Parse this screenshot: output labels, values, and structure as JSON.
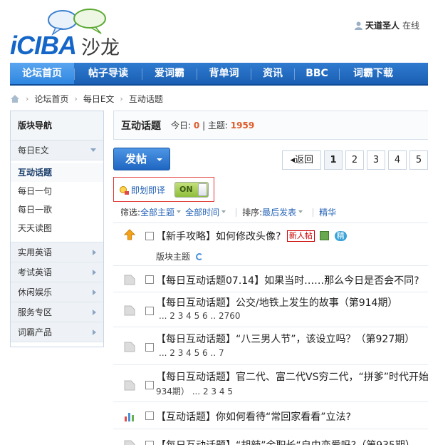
{
  "brand": {
    "logo_text": "iCIBA",
    "logo_cn": "沙龙",
    "colors": {
      "primary": "#1466c8",
      "nav": "#1a5fb3",
      "accent_red": "#e05a2a"
    }
  },
  "user": {
    "name": "天道圣人",
    "status": "在线"
  },
  "nav": {
    "items": [
      "论坛首页",
      "帖子导读",
      "爱词霸",
      "背单词",
      "资讯",
      "BBC",
      "词霸下载"
    ]
  },
  "breadcrumb": {
    "items": [
      "论坛首页",
      "每日E文",
      "互动话题"
    ]
  },
  "sidebar": {
    "title": "版块导航",
    "expanded": "每日E文",
    "subs": [
      "互动话题",
      "每日一句",
      "每日一歌",
      "天天读图"
    ],
    "categories": [
      "实用英语",
      "考试英语",
      "休闲娱乐",
      "服务专区",
      "词霸产品"
    ]
  },
  "forum": {
    "title": "互动话题",
    "today_label": "今日:",
    "today": "0",
    "topics_label": "主题:",
    "topics": "1959"
  },
  "toolbar": {
    "post_label": "发帖",
    "prev_label": "返回",
    "pages": [
      "1",
      "2",
      "3",
      "4",
      "5"
    ]
  },
  "translate": {
    "label": "即划即译",
    "toggle": "ON"
  },
  "filters": {
    "filter_label": "筛选:",
    "all_topics": "全部主题",
    "all_time": "全部时间",
    "sort_label": "排序:",
    "sort_value": "最后发表",
    "digest": "精华"
  },
  "threads": {
    "pinned_title": "【新手攻略】如何修改头像?",
    "badge_new": "新人帖",
    "badge_jing": "精",
    "section_label": "版块主题",
    "items": [
      {
        "title": "【每日互动话题07.14】如果当时……那么今日是否会不同?",
        "pages": ""
      },
      {
        "title": "【每日互动话题】公交/地铁上发生的故事（第914期）",
        "pages": "... 2 3 4 5 6 .. 2760"
      },
      {
        "title": "【每日互动话题】“八三男人节”，该设立吗？（第927期）",
        "pages": "... 2 3 4 5 6 .. 7"
      },
      {
        "title": "【每日互动话题】官二代、富二代VS穷二代，“拼爹”时代开始了",
        "pages": "934期）  ... 2 3 4 5"
      },
      {
        "title": "【互动话题】你如何看待“常回家看看”立法?",
        "pages": ""
      },
      {
        "title": "【每日互动话题】“胡辣”金职长“自由恋爱吗?（第935期）",
        "pages": ""
      }
    ]
  }
}
